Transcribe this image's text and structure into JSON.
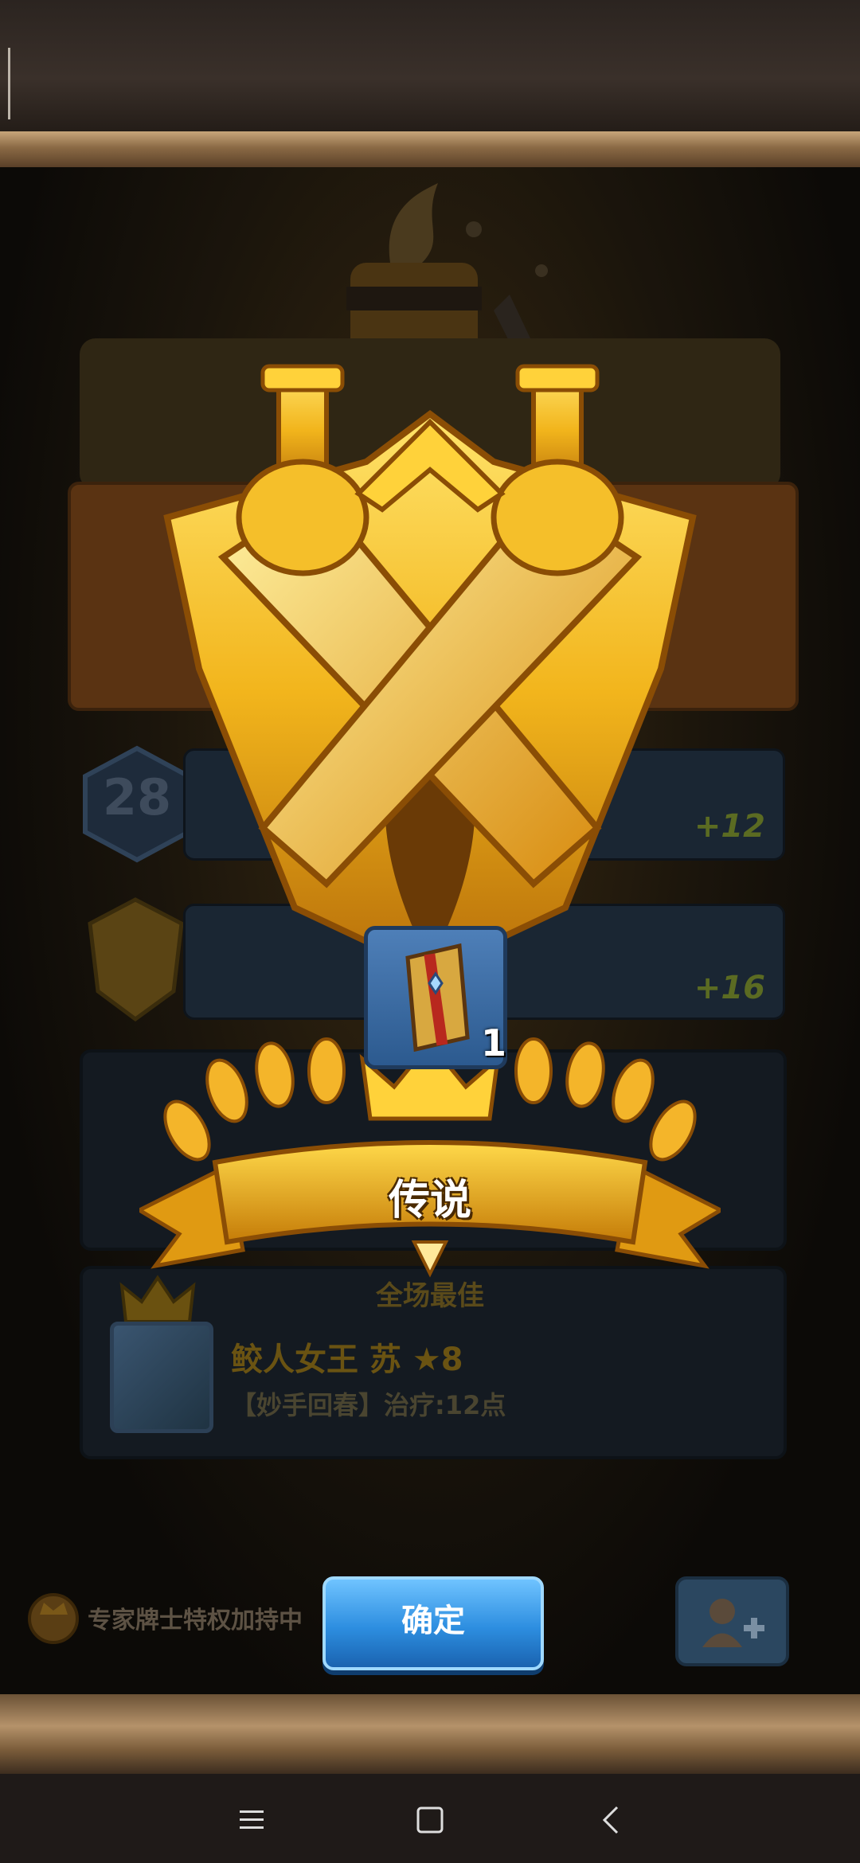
{
  "level_badge": {
    "value": "28"
  },
  "rows": [
    {
      "bonus": "+12"
    },
    {
      "bonus": "+16"
    }
  ],
  "mvp": {
    "title": "全场最佳",
    "hero_name": "鲛人女王 苏 ★8",
    "skill_text": "【妙手回春】治疗:12点"
  },
  "reward": {
    "item_icon": "card-pack-icon",
    "count": "1",
    "rank_label": "传说"
  },
  "footer": {
    "expert_status": "专家牌士特权加持中",
    "confirm_label": "确定",
    "add_friend_icon": "add-friend-icon"
  },
  "colors": {
    "gold": "#f2b51c",
    "confirm_blue": "#2d8ee0",
    "bonus_green": "#5b6b22"
  },
  "system_nav": [
    "menu-icon",
    "home-icon",
    "back-icon"
  ]
}
